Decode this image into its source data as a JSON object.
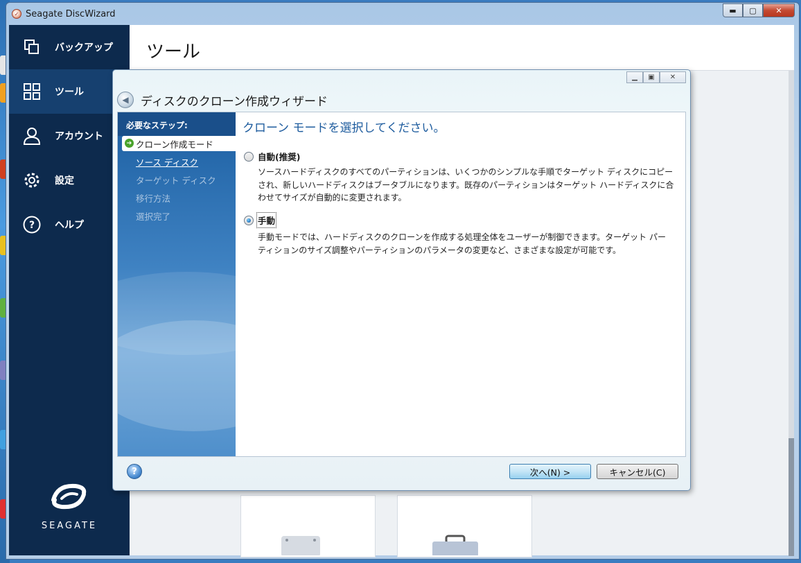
{
  "window": {
    "title": "Seagate DiscWizard",
    "minimize": "▬",
    "maximize": "▢",
    "close": "✕"
  },
  "sidebar": {
    "items": [
      {
        "label": "バックアップ",
        "icon": "copy-icon"
      },
      {
        "label": "ツール",
        "icon": "grid-icon"
      },
      {
        "label": "アカウント",
        "icon": "person-icon"
      },
      {
        "label": "設定",
        "icon": "gear-icon"
      },
      {
        "label": "ヘルプ",
        "icon": "question-icon"
      }
    ],
    "active_index": 1,
    "logo_text": "SEAGATE"
  },
  "main": {
    "title": "ツール"
  },
  "wizard": {
    "title": "ディスクのクローン作成ウィザード",
    "steps_heading": "必要なステップ:",
    "steps": [
      {
        "label": "クローン作成モード",
        "state": "current"
      },
      {
        "label": "ソース ディスク",
        "state": "link"
      },
      {
        "label": "ターゲット ディスク",
        "state": "future"
      },
      {
        "label": "移行方法",
        "state": "future"
      },
      {
        "label": "選択完了",
        "state": "future"
      }
    ],
    "page_heading": "クローン モードを選択してください。",
    "options": [
      {
        "label": "自動(推奨)",
        "checked": false,
        "desc_lines": [
          "ソースハードディスクのすべてのパーティションは、いくつかのシンプルな手順でターゲット ディスクにコピー",
          "され、新しいハードディスクはブータブルになります。既存のパーティションはターゲット ハードディスクに合",
          "わせてサイズが自動的に変更されます。"
        ]
      },
      {
        "label": "手動",
        "checked": true,
        "desc_lines": [
          "手動モードでは、ハードディスクのクローンを作成する処理全体をユーザーが制御できます。ターゲット パー",
          "ティションのサイズ調整やパーティションのパラメータの変更など、さまざまな設定が可能です。"
        ]
      }
    ],
    "next_button": "次へ(N) >",
    "cancel_button": "キャンセル(C)",
    "help": "?"
  }
}
